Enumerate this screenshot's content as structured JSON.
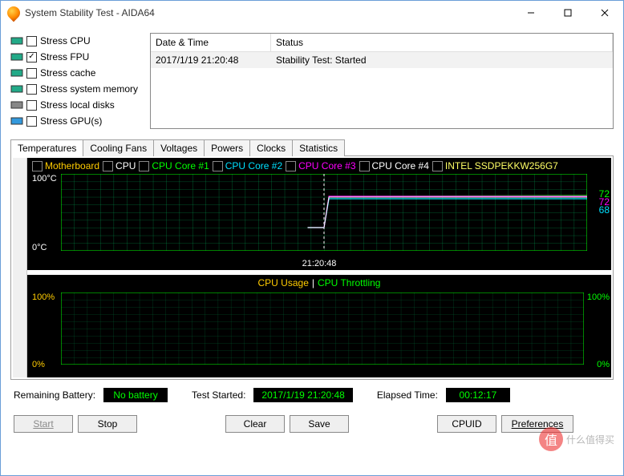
{
  "window": {
    "title": "System Stability Test - AIDA64"
  },
  "stress": [
    {
      "label": "Stress CPU",
      "checked": false
    },
    {
      "label": "Stress FPU",
      "checked": true
    },
    {
      "label": "Stress cache",
      "checked": false
    },
    {
      "label": "Stress system memory",
      "checked": false
    },
    {
      "label": "Stress local disks",
      "checked": false
    },
    {
      "label": "Stress GPU(s)",
      "checked": false
    }
  ],
  "log": {
    "headers": {
      "datetime": "Date & Time",
      "status": "Status"
    },
    "rows": [
      {
        "datetime": "2017/1/19 21:20:48",
        "status": "Stability Test: Started"
      }
    ]
  },
  "tabs": [
    "Temperatures",
    "Cooling Fans",
    "Voltages",
    "Powers",
    "Clocks",
    "Statistics"
  ],
  "active_tab": 0,
  "chart1": {
    "legend": [
      {
        "name": "Motherboard",
        "color": "#ffcc00",
        "checked": false
      },
      {
        "name": "CPU",
        "color": "#ffffff",
        "checked": false
      },
      {
        "name": "CPU Core #1",
        "color": "#00ff00",
        "checked": true
      },
      {
        "name": "CPU Core #2",
        "color": "#00e0ff",
        "checked": true
      },
      {
        "name": "CPU Core #3",
        "color": "#ff00ff",
        "checked": true
      },
      {
        "name": "CPU Core #4",
        "color": "#ffffff",
        "checked": true
      },
      {
        "name": "INTEL SSDPEKKW256G7",
        "color": "#ffff66",
        "checked": false
      }
    ],
    "y_top": "100°C",
    "y_bot": "0°C",
    "marker_label": "21:20:48",
    "readouts": [
      {
        "value": "72",
        "color": "#00ff00"
      },
      {
        "value": "72",
        "color": "#ff00ff"
      },
      {
        "value": "68",
        "color": "#00e0ff"
      }
    ]
  },
  "chart2": {
    "title_a": "CPU Usage",
    "title_sep": "|",
    "title_b": "CPU Throttling",
    "yl_top": "100%",
    "yl_bot": "0%",
    "yr_top": "100%",
    "yr_bot": "0%"
  },
  "status": {
    "battery_label": "Remaining Battery:",
    "battery_value": "No battery",
    "started_label": "Test Started:",
    "started_value": "2017/1/19 21:20:48",
    "elapsed_label": "Elapsed Time:",
    "elapsed_value": "00:12:17"
  },
  "buttons": {
    "start": "Start",
    "stop": "Stop",
    "clear": "Clear",
    "save": "Save",
    "cpuid": "CPUID",
    "preferences": "Preferences"
  },
  "watermark": "什么值得买",
  "chart_data": [
    {
      "type": "line",
      "title": "Temperatures",
      "ylabel": "°C",
      "ylim": [
        0,
        100
      ],
      "x_marker": "21:20:48",
      "series": [
        {
          "name": "CPU Core #1",
          "color": "#00ff00",
          "value_after_start": 72,
          "value_before_start": 30
        },
        {
          "name": "CPU Core #2",
          "color": "#00e0ff",
          "value_after_start": 68,
          "value_before_start": 30
        },
        {
          "name": "CPU Core #3",
          "color": "#ff00ff",
          "value_after_start": 72,
          "value_before_start": 30
        },
        {
          "name": "CPU Core #4",
          "color": "#ffffff",
          "value_after_start": 70,
          "value_before_start": 30
        }
      ],
      "annotations": [
        "Step jump at 21:20:48 from ~30°C to ~70°C, then flat"
      ]
    },
    {
      "type": "line",
      "title": "CPU Usage | CPU Throttling",
      "ylim": [
        0,
        100
      ],
      "series": [
        {
          "name": "CPU Usage",
          "color": "#ffcc00",
          "values": []
        },
        {
          "name": "CPU Throttling",
          "color": "#00ff00",
          "values": []
        }
      ]
    }
  ]
}
